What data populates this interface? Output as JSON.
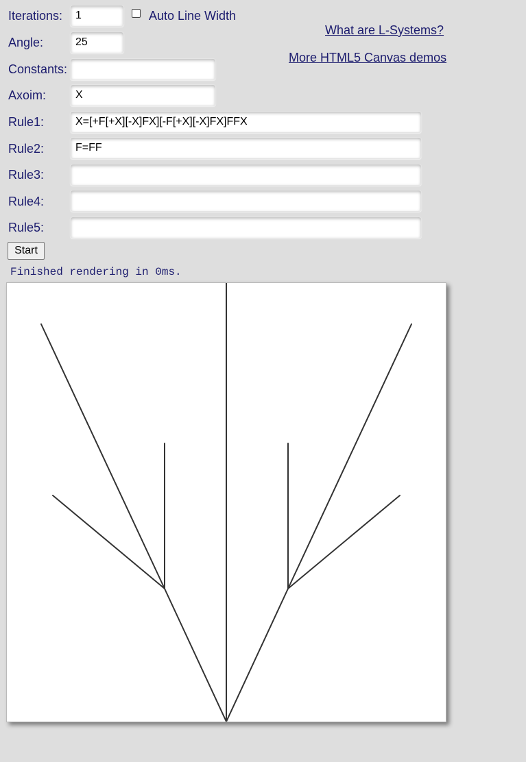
{
  "form": {
    "iterations": {
      "label": "Iterations:",
      "value": "1"
    },
    "auto_line_width": {
      "label": "Auto Line Width",
      "checked": false
    },
    "angle": {
      "label": "Angle:",
      "value": "25"
    },
    "constants": {
      "label": "Constants:",
      "value": ""
    },
    "axiom": {
      "label": "Axoim:",
      "value": "X"
    },
    "rules": [
      {
        "label": "Rule1:",
        "value": "X=[+F[+X][-X]FX][-F[+X][-X]FX]FFX"
      },
      {
        "label": "Rule2:",
        "value": "F=FF"
      },
      {
        "label": "Rule3:",
        "value": ""
      },
      {
        "label": "Rule4:",
        "value": ""
      },
      {
        "label": "Rule5:",
        "value": ""
      }
    ],
    "start_label": "Start"
  },
  "links": {
    "what_are": "What are L-Systems?",
    "more_demos": "More HTML5 Canvas demos"
  },
  "status": "Finished rendering in 0ms.",
  "canvas": {
    "stroke_color": "#333333",
    "background": "#ffffff"
  }
}
